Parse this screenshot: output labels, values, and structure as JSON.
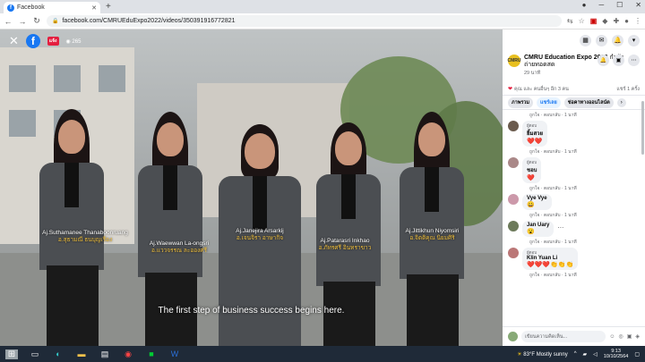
{
  "browser": {
    "tab_title": "Facebook",
    "url": "facebook.com/CMRUEduExpo2022/videos/350391916772821"
  },
  "video": {
    "viewer_count": "265",
    "live_badge": "แจ้ง",
    "subtitle": "The first step of business success begins here.",
    "people": [
      {
        "name_en": "Aj.Suthamanee Thanaboonruang",
        "name_th": "อ.สุธามณี ธนบุญเรือง"
      },
      {
        "name_en": "Aj.Waewwan La-ongsri",
        "name_th": "อ.แววจรรณ ละอองศรี"
      },
      {
        "name_en": "Aj.Janejira Arsarkij",
        "name_th": "อ.เจนจิรา อาษากิจ"
      },
      {
        "name_en": "Aj.Patarasri Inkhao",
        "name_th": "อ.ภัทรศรี อินทราขาว"
      },
      {
        "name_en": "Aj.Jittikhun Niyomsiri",
        "name_th": "อ.จิตติคุณ นิยมศิริ"
      }
    ]
  },
  "panel": {
    "page_name": "CMRU Education Expo 2022",
    "page_name_suffix": "กำลัง",
    "page_status": "ถ่ายทอดสด",
    "post_time": "29 นาที",
    "reactions_text": "คุณ และ คนอื่นๆ อีก 3 คน",
    "shares_text": "แชร์ 1 ครั้ง",
    "pills": [
      "ภาพรวม",
      "แชร์เลย",
      "ช่อคาทางออนไลน์ต"
    ],
    "comments": [
      {
        "meta": "ถูกใจ · ตอบกลับ · 1 นาที"
      },
      {
        "tag": "ผู้ตอบ",
        "name": "ยิ้มสวย",
        "text": "❤️❤️",
        "meta": "ถูกใจ · ตอบกลับ · 1 นาที"
      },
      {
        "tag": "ผู้ตอบ",
        "name": "ชอบ",
        "text": "❤️",
        "meta": "ถูกใจ · ตอบกลับ · 1 นาที"
      },
      {
        "name": "Vye Vye",
        "text": "😀",
        "meta": "ถูกใจ · ตอบกลับ · 1 นาที"
      },
      {
        "name": "Jan Uary",
        "text": "😮",
        "meta": "ถูกใจ · ตอบกลับ · 1 นาที"
      },
      {
        "tag": "ผู้ตอบ",
        "name": "Klin Yuan Li",
        "text": "❤️❤️❤️👏👏👏",
        "meta": "ถูกใจ · ตอบกลับ · 1 นาที"
      }
    ],
    "composer_placeholder": "เขียนความคิดเห็น..."
  },
  "taskbar": {
    "weather": "83°F  Mostly sunny",
    "time": "9:13",
    "date": "10/10/2564"
  }
}
